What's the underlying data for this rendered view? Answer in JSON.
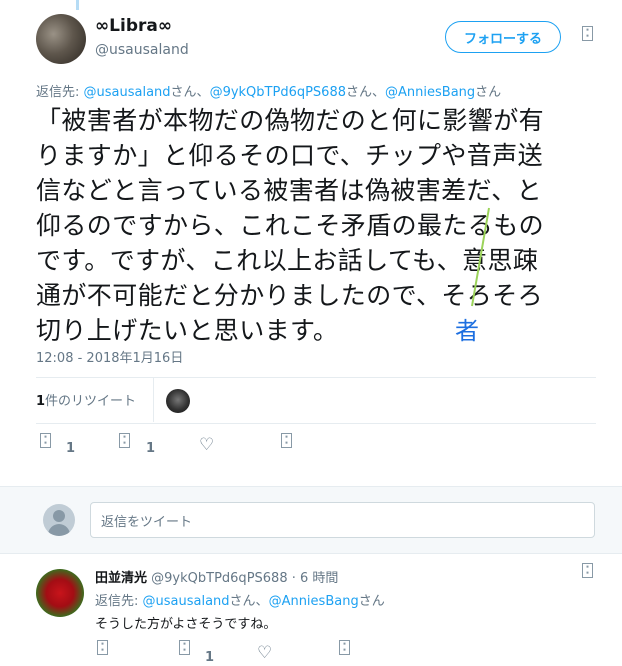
{
  "main_tweet": {
    "display_name": "∞Libra∞",
    "handle": "@usausaland",
    "follow_label": "フォローする",
    "reply_to_prefix": "返信先: ",
    "reply_to_1": "@usausaland",
    "reply_to_sep1": "さん、",
    "reply_to_2": "@9ykQbTPd6qPS688",
    "reply_to_sep2": "さん、",
    "reply_to_3": "@AnniesBang",
    "reply_to_suffix": "さん",
    "text_lines": [
      "「被害者が本物だの偽物だのと何に影響が有",
      "りますか」と仰るその口で、チップや音声送",
      "信などと言っている被害者は偽被害差だ、と",
      "仰るのですから、これこそ矛盾の最たるもの",
      "です。ですが、これ以上お話しても、意思疎",
      "通が不可能だと分かりましたので、そろそろ",
      "切り上げたいと思います。"
    ],
    "annotation": "者",
    "timestamp": "12:08 - 2018年1月16日",
    "retweet_count": "1",
    "retweet_label": "件のリツイート",
    "reply_count": "1",
    "rt_count": "1"
  },
  "reply_box": {
    "placeholder": "返信をツイート"
  },
  "reply_tweet": {
    "display_name": "田並清光",
    "handle": "@9ykQbTPd6qPS688",
    "time": " · 6 時間",
    "reply_to_prefix": "返信先: ",
    "reply_to_1": "@usausaland",
    "reply_to_sep": "さん、",
    "reply_to_2": "@AnniesBang",
    "reply_to_suffix": "さん",
    "text": "そうした方がよさそうですね。",
    "rt_count": "1"
  },
  "icon_glyph_placeholder": "▯",
  "colors": {
    "link": "#1da1f2",
    "muted": "#657786",
    "annotation": "#1d6fe0",
    "annotation_line": "#9bd35a"
  }
}
